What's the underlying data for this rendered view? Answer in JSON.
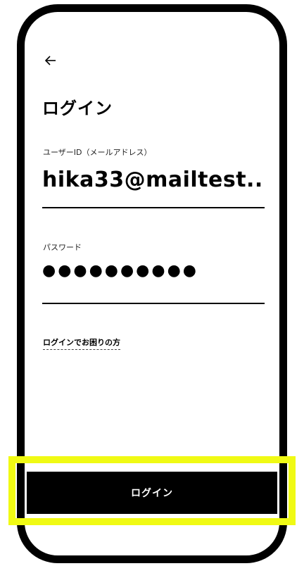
{
  "header": {
    "back_icon": "arrow-left-icon",
    "title": "ログイン"
  },
  "form": {
    "userid": {
      "label": "ユーザーID（メールアドレス）",
      "value": "hika33@mailtest..."
    },
    "password": {
      "label": "パスワード",
      "value": "●●●●●●●●●●"
    },
    "help_link": "ログインでお困りの方"
  },
  "actions": {
    "login_label": "ログイン"
  },
  "colors": {
    "highlight": "#f0fa14",
    "button_bg": "#000000",
    "button_text": "#ffffff"
  }
}
